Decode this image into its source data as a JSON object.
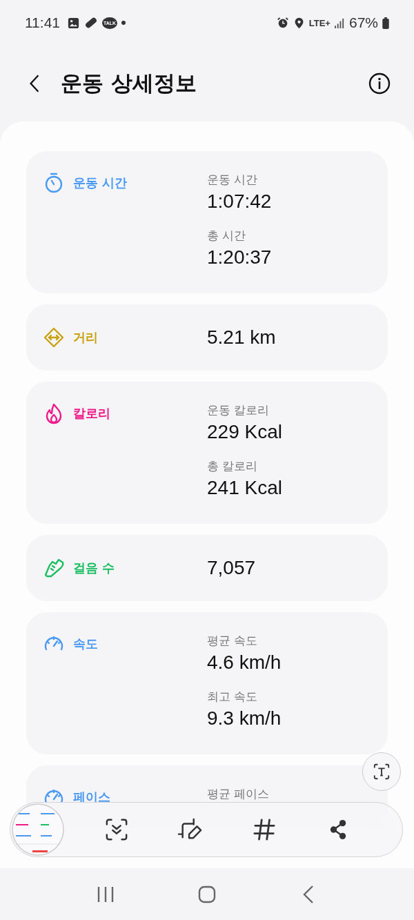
{
  "status_bar": {
    "time": "11:41",
    "talk_badge": "TALK",
    "network": "LTE+",
    "battery": "67%"
  },
  "header": {
    "title": "운동 상세정보"
  },
  "sections": [
    {
      "title": "운동 시간",
      "color": "#4a9af5",
      "entries": [
        {
          "label": "운동 시간",
          "value": "1:07:42"
        },
        {
          "label": "총 시간",
          "value": "1:20:37"
        }
      ]
    },
    {
      "title": "거리",
      "color": "#c9a10c",
      "entries": [
        {
          "value": "5.21 km"
        }
      ]
    },
    {
      "title": "칼로리",
      "color": "#f0198a",
      "entries": [
        {
          "label": "운동 칼로리",
          "value": "229 Kcal"
        },
        {
          "label": "총 칼로리",
          "value": "241 Kcal"
        }
      ]
    },
    {
      "title": "걸음 수",
      "color": "#1bbf62",
      "entries": [
        {
          "value": "7,057"
        }
      ]
    },
    {
      "title": "속도",
      "color": "#4a9af5",
      "entries": [
        {
          "label": "평균 속도",
          "value": "4.6 km/h"
        },
        {
          "label": "최고 속도",
          "value": "9.3 km/h"
        }
      ]
    },
    {
      "title": "페이스",
      "color": "#4a9af5",
      "entries": [
        {
          "label": "평균 페이스"
        }
      ]
    }
  ]
}
